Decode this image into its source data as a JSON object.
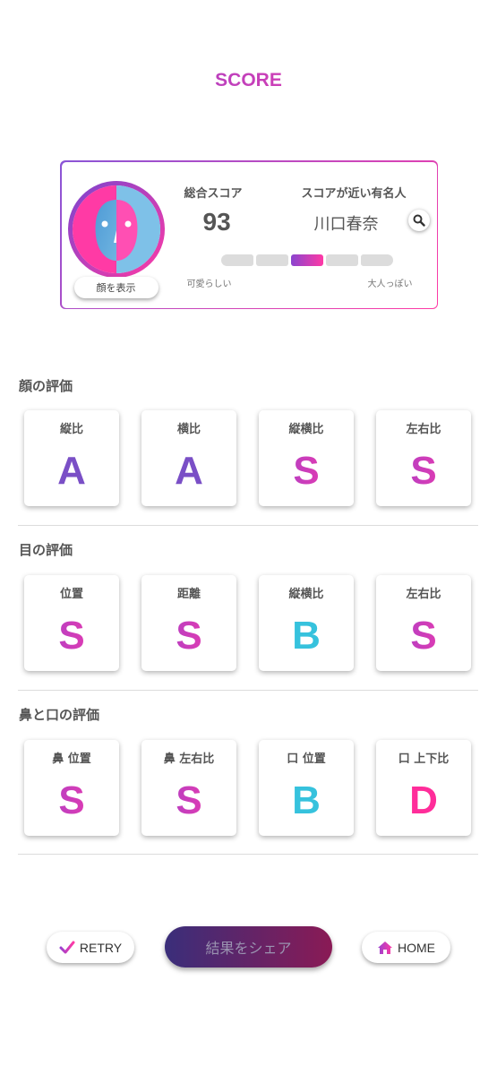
{
  "title": "SCORE",
  "summary": {
    "total_label": "総合スコア",
    "total_value": "93",
    "celebrity_label": "スコアが近い有名人",
    "celebrity_name": "川口春奈",
    "show_face_label": "顔を表示",
    "scale_left_label": "可愛らしい",
    "scale_right_label": "大人っぽい",
    "scale_active_index": 2,
    "scale_segments": 5
  },
  "sections": [
    {
      "title": "顔の評価",
      "items": [
        {
          "label": "縦比",
          "grade": "A"
        },
        {
          "label": "横比",
          "grade": "A"
        },
        {
          "label": "縦横比",
          "grade": "S"
        },
        {
          "label": "左右比",
          "grade": "S"
        }
      ]
    },
    {
      "title": "目の評価",
      "items": [
        {
          "label": "位置",
          "grade": "S"
        },
        {
          "label": "距離",
          "grade": "S"
        },
        {
          "label": "縦横比",
          "grade": "B"
        },
        {
          "label": "左右比",
          "grade": "S"
        }
      ]
    },
    {
      "title": "鼻と口の評価",
      "items": [
        {
          "label": "鼻 位置",
          "grade": "S"
        },
        {
          "label": "鼻 左右比",
          "grade": "S"
        },
        {
          "label": "口 位置",
          "grade": "B"
        },
        {
          "label": "口 上下比",
          "grade": "D"
        }
      ]
    }
  ],
  "buttons": {
    "retry": "RETRY",
    "share": "結果をシェア",
    "home": "HOME"
  },
  "icons": {
    "retry": "check-icon",
    "home": "house-icon",
    "search": "magnifier-icon"
  },
  "colors": {
    "accent_purple": "#7a4fc6",
    "accent_pink": "#ff3aa5",
    "grade_b": "#36c2dd",
    "grade_d": "#ff2d9a"
  }
}
